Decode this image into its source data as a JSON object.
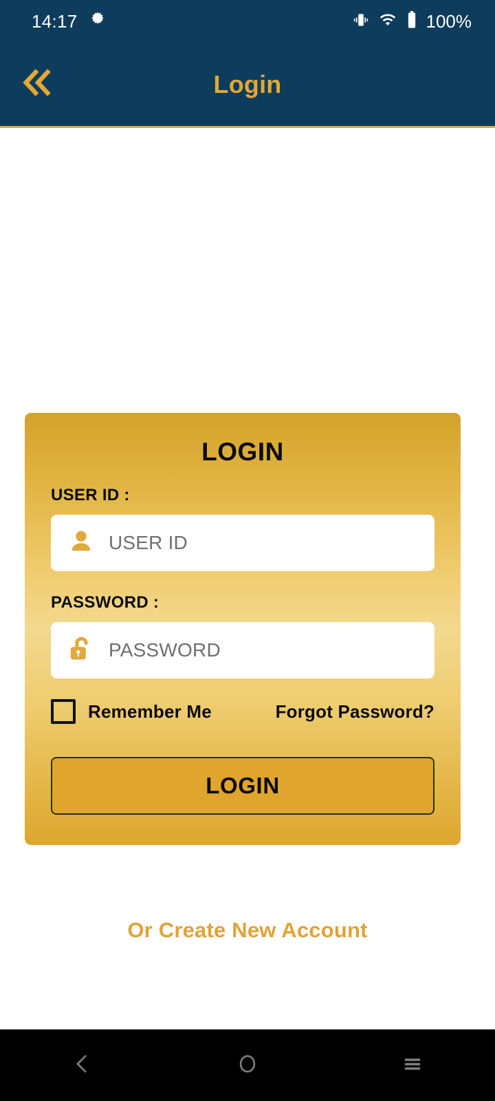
{
  "statusbar": {
    "time": "14:17",
    "gear_icon": "gear-icon",
    "vibrate_icon": "vibrate-icon",
    "wifi_icon": "wifi-icon",
    "battery_icon": "battery-icon",
    "battery_text": "100%"
  },
  "appbar": {
    "back_icon": "double-chevron-left-icon",
    "title": "Login",
    "bg_color": "#0e3c5d",
    "title_color": "#e3a832",
    "accent_border": "#d9a93a"
  },
  "card": {
    "title": "LOGIN",
    "gradient_top": "#d5a32c",
    "gradient_mid": "#f3d98f",
    "gradient_bottom": "#dda72e",
    "userid": {
      "label": "USER ID :",
      "icon": "user-icon",
      "placeholder": "USER ID",
      "value": ""
    },
    "password": {
      "label": "PASSWORD :",
      "icon": "unlocked-padlock-icon",
      "placeholder": "PASSWORD",
      "value": ""
    },
    "remember_me": {
      "label": "Remember Me",
      "checked": false
    },
    "forgot_password": "Forgot Password?",
    "submit_label": "LOGIN",
    "submit_color": "#e0a52c"
  },
  "create_account": {
    "label": "Or Create New Account",
    "color": "#e0a338"
  },
  "navbar": {
    "back_icon": "chevron-left-icon",
    "home_icon": "circle-home-icon",
    "recents_icon": "hamburger-recents-icon",
    "bg_color": "#000000",
    "icon_color": "#7d7d7d"
  }
}
